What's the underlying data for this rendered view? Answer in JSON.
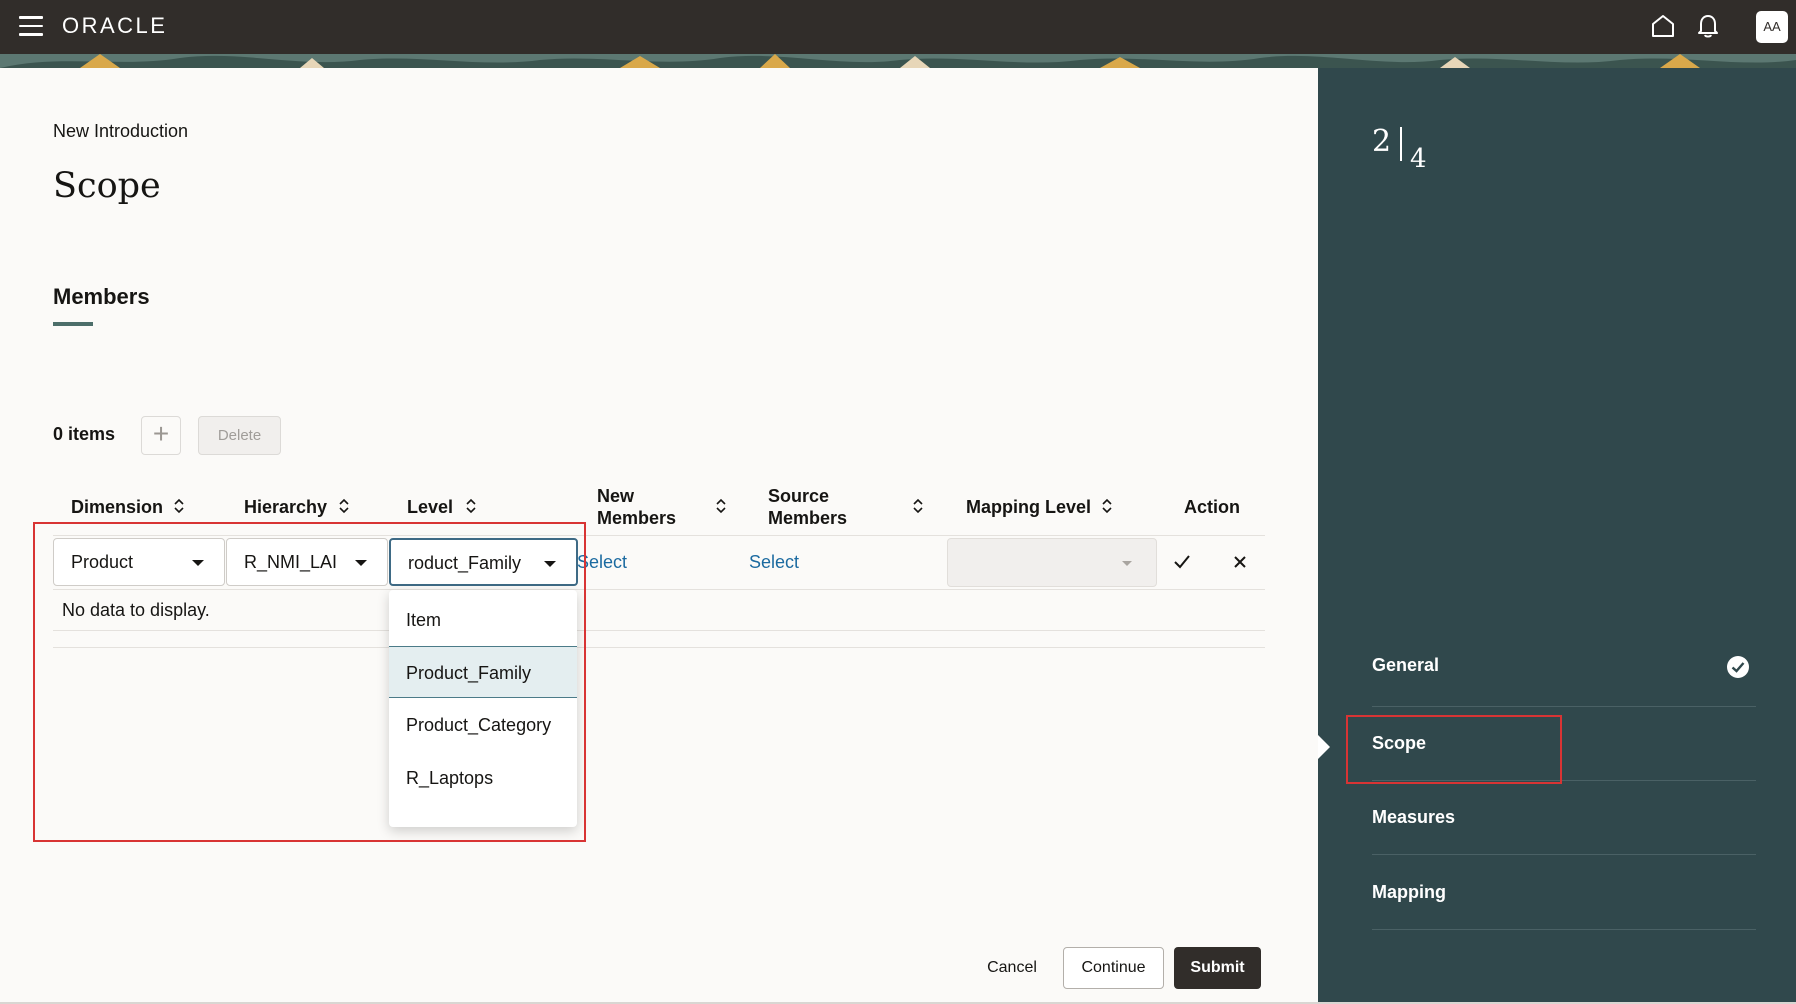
{
  "header": {
    "brand": "ORACLE",
    "avatar_initials": "AA"
  },
  "page": {
    "breadcrumb": "New Introduction",
    "title": "Scope",
    "section_tab": "Members",
    "items_count": "0 items",
    "delete_label": "Delete",
    "add_label": "+"
  },
  "table": {
    "columns": {
      "dimension": "Dimension",
      "hierarchy": "Hierarchy",
      "level": "Level",
      "new_members_1": "New",
      "new_members_2": "Members",
      "source_members_1": "Source",
      "source_members_2": "Members",
      "mapping_level": "Mapping Level",
      "action": "Action"
    },
    "row": {
      "dimension_value": "Product",
      "hierarchy_value": "R_NMI_LAI",
      "level_value": "roduct_Family",
      "new_members_link": "Select",
      "source_members_link": "Select",
      "mapping_level_value": ""
    },
    "empty_text": "No data to display."
  },
  "level_dropdown": {
    "options": [
      "Item",
      "Product_Family",
      "Product_Category",
      "R_Laptops"
    ],
    "selected": "Product_Family"
  },
  "train": {
    "current": "2",
    "total": "4",
    "steps": [
      {
        "label": "General",
        "status": "completed"
      },
      {
        "label": "Scope",
        "status": "current"
      },
      {
        "label": "Measures",
        "status": "pending"
      },
      {
        "label": "Mapping",
        "status": "pending"
      }
    ]
  },
  "footer": {
    "cancel": "Cancel",
    "continue": "Continue",
    "submit": "Submit"
  },
  "colors": {
    "header_bg": "#312d2a",
    "side_panel_bg": "#30484c",
    "link": "#1b6aa0",
    "highlight": "#d83434"
  }
}
